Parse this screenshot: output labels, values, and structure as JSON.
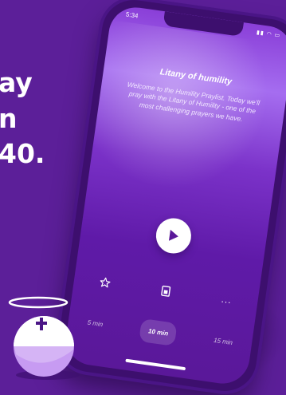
{
  "headline": {
    "line1": "ay",
    "line2": "n",
    "line3": "40."
  },
  "phone": {
    "status": {
      "time": "5:34",
      "icons": "▮▮ ◠ ▭"
    },
    "prayer": {
      "title": "Litany of humility",
      "description": "Welcome to the Humility Praylist. Today we'll pray with the Litany of Humility - one of the most challenging prayers we have."
    },
    "actions": {
      "star_icon": "star-icon",
      "note_icon": "note-icon",
      "more_label": "..."
    },
    "durations": [
      {
        "label": "5 min",
        "selected": false
      },
      {
        "label": "10 min",
        "selected": true
      },
      {
        "label": "15 min",
        "selected": false
      }
    ]
  },
  "colors": {
    "background": "#5c1f99",
    "accent": "#ffffff",
    "mascot_body": "#c79bf2"
  }
}
